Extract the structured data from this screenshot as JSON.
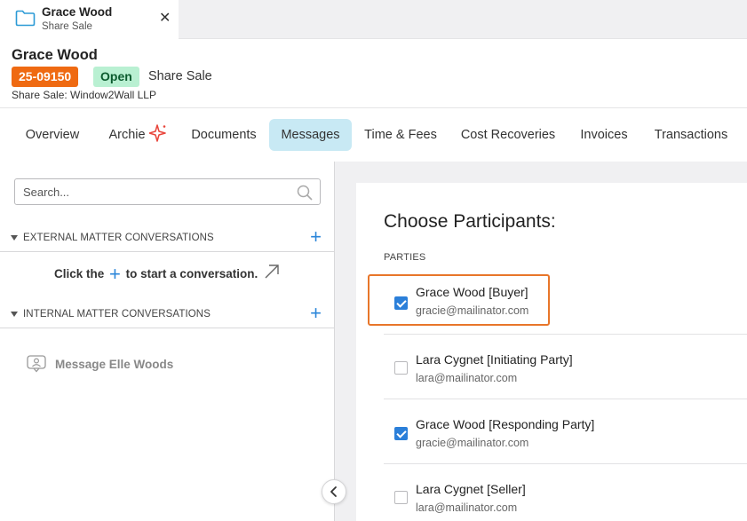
{
  "tab": {
    "title": "Grace Wood",
    "subtitle": "Share Sale",
    "close": "✕"
  },
  "matter": {
    "title": "Grace Wood",
    "number": "25-09150",
    "status": "Open",
    "type": "Share Sale",
    "subtitle": "Share Sale: Window2Wall LLP"
  },
  "nav": {
    "items": [
      {
        "label": "Overview"
      },
      {
        "label": "Archie"
      },
      {
        "label": "Documents"
      },
      {
        "label": "Messages",
        "active": true
      },
      {
        "label": "Time & Fees"
      },
      {
        "label": "Cost Recoveries"
      },
      {
        "label": "Invoices"
      },
      {
        "label": "Transactions"
      }
    ]
  },
  "left": {
    "search_placeholder": "Search...",
    "external_label": "EXTERNAL MATTER CONVERSATIONS",
    "hint_before": "Click the",
    "hint_plus": "+",
    "hint_after": "to start a conversation.",
    "internal_label": "INTERNAL MATTER CONVERSATIONS",
    "message_elle": "Message Elle Woods"
  },
  "right": {
    "heading": "Choose Participants:",
    "parties_label": "PARTIES",
    "parties": [
      {
        "name": "Grace Wood [Buyer]",
        "email": "gracie@mailinator.com",
        "checked": true
      },
      {
        "name": "Lara Cygnet [Initiating Party]",
        "email": "lara@mailinator.com",
        "checked": false
      },
      {
        "name": "Grace Wood [Responding Party]",
        "email": "gracie@mailinator.com",
        "checked": true
      },
      {
        "name": "Lara Cygnet [Seller]",
        "email": "lara@mailinator.com",
        "checked": false
      }
    ]
  },
  "colors": {
    "accent": "#2b86d9",
    "active_tab": "#c8e9f4",
    "matter_badge": "#ef6a12",
    "open_badge": "#b9f0d2",
    "highlight": "#e8762a"
  }
}
